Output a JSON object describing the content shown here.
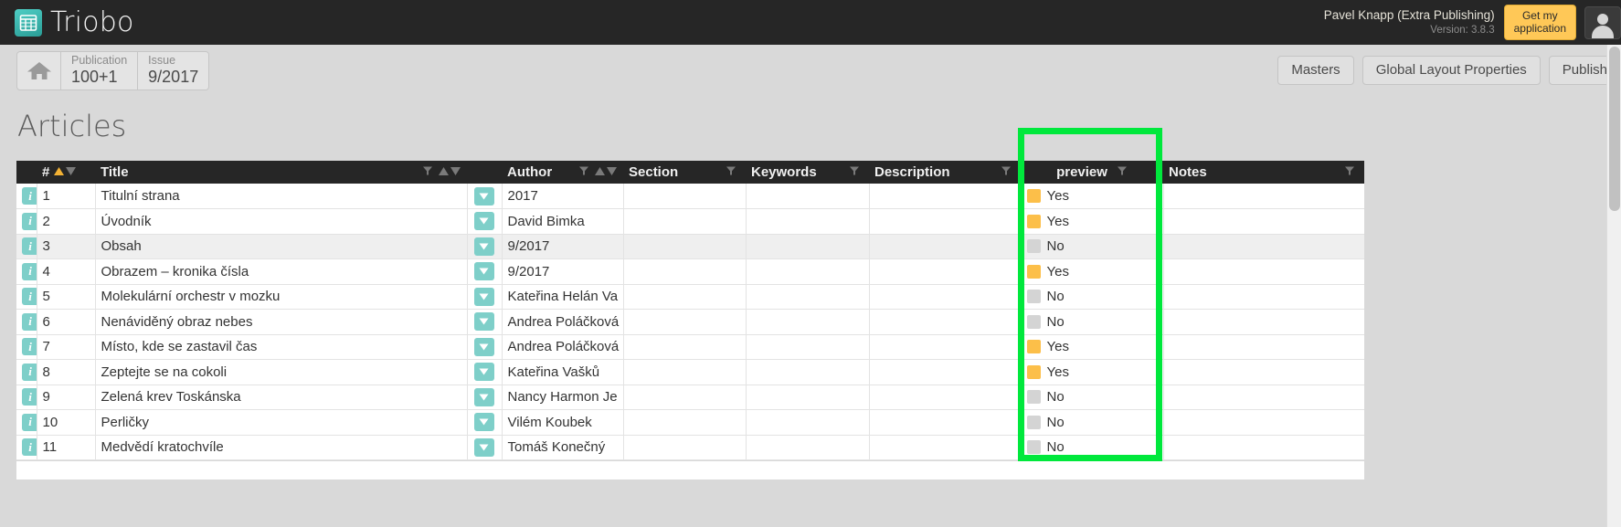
{
  "app": {
    "brand_name": "Triobo",
    "logo_icon": "grid-table-icon"
  },
  "topbar": {
    "user_name": "Pavel Knapp (Extra Publishing)",
    "version": "Version: 3.8.3",
    "get_app_line1": "Get my",
    "get_app_line2": "application",
    "avatar_icon": "user-avatar-icon",
    "accent_color": "#ffc857"
  },
  "breadcrumb": {
    "home_icon": "home-icon",
    "items": [
      {
        "label": "Publication",
        "value": "100+1"
      },
      {
        "label": "Issue",
        "value": "9/2017"
      }
    ]
  },
  "toolbar": {
    "buttons": [
      {
        "label": "Masters"
      },
      {
        "label": "Global Layout Properties"
      },
      {
        "label": "Publish"
      }
    ]
  },
  "page": {
    "title": "Articles"
  },
  "table": {
    "columns": [
      {
        "key": "info",
        "label": "",
        "filter": false,
        "sort": false
      },
      {
        "key": "num",
        "label": "#",
        "filter": false,
        "sort": true
      },
      {
        "key": "title",
        "label": "Title",
        "filter": true,
        "sort": true
      },
      {
        "key": "author",
        "label": "Author",
        "filter": true,
        "sort": true
      },
      {
        "key": "section",
        "label": "Section",
        "filter": true,
        "sort": false
      },
      {
        "key": "keywords",
        "label": "Keywords",
        "filter": true,
        "sort": false
      },
      {
        "key": "description",
        "label": "Description",
        "filter": true,
        "sort": false
      },
      {
        "key": "preview",
        "label": "preview",
        "filter": true,
        "sort": false
      },
      {
        "key": "notes",
        "label": "Notes",
        "filter": true,
        "sort": false
      }
    ],
    "sorted_by": "#",
    "sort_direction": "asc",
    "rows": [
      {
        "num": "1",
        "title": "Titulní strana",
        "author": "2017",
        "section": "",
        "keywords": "",
        "description": "",
        "preview": "Yes",
        "notes": ""
      },
      {
        "num": "2",
        "title": "Úvodník",
        "author": "David Bimka",
        "section": "",
        "keywords": "",
        "description": "",
        "preview": "Yes",
        "notes": ""
      },
      {
        "num": "3",
        "title": "Obsah",
        "author": "9/2017",
        "section": "",
        "keywords": "",
        "description": "",
        "preview": "No",
        "notes": ""
      },
      {
        "num": "4",
        "title": "Obrazem – kronika čísla",
        "author": "9/2017",
        "section": "",
        "keywords": "",
        "description": "",
        "preview": "Yes",
        "notes": ""
      },
      {
        "num": "5",
        "title": "Molekulární orchestr v mozku",
        "author": "Kateřina Helán Va",
        "section": "",
        "keywords": "",
        "description": "",
        "preview": "No",
        "notes": ""
      },
      {
        "num": "6",
        "title": "Nenáviděný obraz nebes",
        "author": "Andrea Poláčková",
        "section": "",
        "keywords": "",
        "description": "",
        "preview": "No",
        "notes": ""
      },
      {
        "num": "7",
        "title": "Místo, kde se zastavil čas",
        "author": "Andrea Poláčková",
        "section": "",
        "keywords": "",
        "description": "",
        "preview": "Yes",
        "notes": ""
      },
      {
        "num": "8",
        "title": "Zeptejte se na cokoli",
        "author": "Kateřina Vašků",
        "section": "",
        "keywords": "",
        "description": "",
        "preview": "Yes",
        "notes": ""
      },
      {
        "num": "9",
        "title": "Zelená krev Toskánska",
        "author": "Nancy Harmon Je",
        "section": "",
        "keywords": "",
        "description": "",
        "preview": "No",
        "notes": ""
      },
      {
        "num": "10",
        "title": "Perličky",
        "author": "Vilém Koubek",
        "section": "",
        "keywords": "",
        "description": "",
        "preview": "No",
        "notes": ""
      },
      {
        "num": "11",
        "title": "Medvědí kratochvíle",
        "author": "Tomáš Konečný",
        "section": "",
        "keywords": "",
        "description": "",
        "preview": "No",
        "notes": ""
      }
    ]
  },
  "highlight": {
    "target_column": "preview",
    "color": "#00e83c"
  },
  "colors": {
    "header_bg": "#262626",
    "teal_accent": "#7ecfc9",
    "yes_swatch": "#fcbf49",
    "no_swatch": "#d4d4d4",
    "sort_active": "#f2b134"
  }
}
